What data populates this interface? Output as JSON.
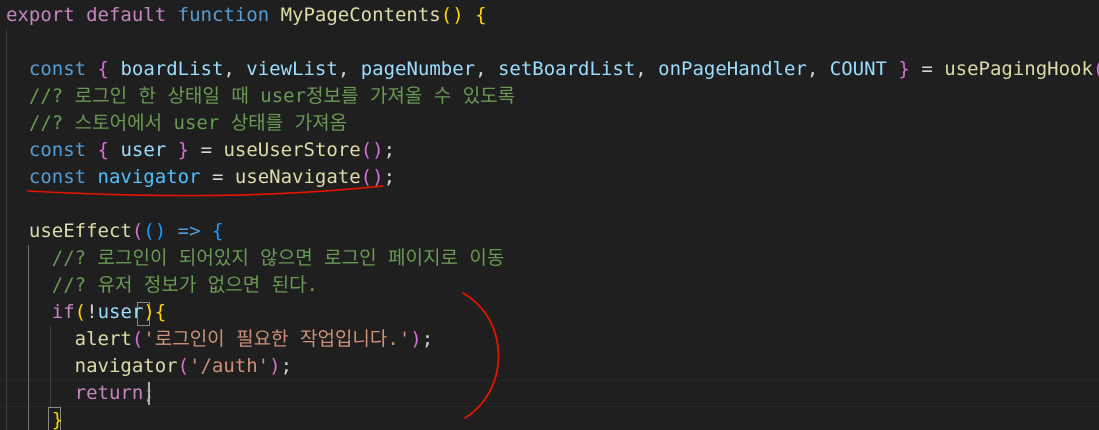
{
  "editor": {
    "colors": {
      "background": "#1f1f1f",
      "keyword": "#569cd6",
      "control_keyword": "#c586c0",
      "function": "#dcdcaa",
      "variable": "#9cdcfe",
      "constant": "#4fc1ff",
      "string": "#ce9178",
      "comment": "#6a9955",
      "bracket_level1": "#ffd700",
      "bracket_level2": "#da70d6",
      "bracket_level3": "#179fff",
      "annotation_ink": "#e51400"
    },
    "lines": [
      {
        "tokens": [
          {
            "t": "export",
            "c": "kw-ctrl"
          },
          {
            "t": " ",
            "c": "plain"
          },
          {
            "t": "default",
            "c": "kw-ctrl"
          },
          {
            "t": " ",
            "c": "plain"
          },
          {
            "t": "function",
            "c": "kw"
          },
          {
            "t": " ",
            "c": "plain"
          },
          {
            "t": "MyPageContents",
            "c": "fn"
          },
          {
            "t": "()",
            "c": "br1"
          },
          {
            "t": " ",
            "c": "plain"
          },
          {
            "t": "{",
            "c": "br1"
          }
        ]
      },
      {
        "tokens": []
      },
      {
        "tokens": [
          {
            "t": "  ",
            "c": "plain"
          },
          {
            "t": "const",
            "c": "kw"
          },
          {
            "t": " ",
            "c": "plain"
          },
          {
            "t": "{",
            "c": "br2"
          },
          {
            "t": " ",
            "c": "plain"
          },
          {
            "t": "boardList",
            "c": "var"
          },
          {
            "t": ", ",
            "c": "plain"
          },
          {
            "t": "viewList",
            "c": "var"
          },
          {
            "t": ", ",
            "c": "plain"
          },
          {
            "t": "pageNumber",
            "c": "var"
          },
          {
            "t": ", ",
            "c": "plain"
          },
          {
            "t": "setBoardList",
            "c": "var"
          },
          {
            "t": ", ",
            "c": "plain"
          },
          {
            "t": "onPageHandler",
            "c": "var"
          },
          {
            "t": ", ",
            "c": "plain"
          },
          {
            "t": "COUNT",
            "c": "var"
          },
          {
            "t": " ",
            "c": "plain"
          },
          {
            "t": "}",
            "c": "br2"
          },
          {
            "t": " = ",
            "c": "plain"
          },
          {
            "t": "usePagingHook",
            "c": "fn"
          },
          {
            "t": "()",
            "c": "br2"
          },
          {
            "t": ";",
            "c": "plain"
          }
        ]
      },
      {
        "tokens": [
          {
            "t": "  ",
            "c": "plain"
          },
          {
            "t": "//? 로그인 한 상태일 때 ",
            "c": "com"
          },
          {
            "t": "user",
            "c": "com"
          },
          {
            "t": "정보를 가져올 수 있도록",
            "c": "com"
          }
        ]
      },
      {
        "tokens": [
          {
            "t": "  ",
            "c": "plain"
          },
          {
            "t": "//? 스토어에서 ",
            "c": "com"
          },
          {
            "t": "user",
            "c": "com"
          },
          {
            "t": " 상태를 가져옴",
            "c": "com"
          }
        ]
      },
      {
        "tokens": [
          {
            "t": "  ",
            "c": "plain"
          },
          {
            "t": "const",
            "c": "kw"
          },
          {
            "t": " ",
            "c": "plain"
          },
          {
            "t": "{",
            "c": "br2"
          },
          {
            "t": " ",
            "c": "plain"
          },
          {
            "t": "user",
            "c": "var"
          },
          {
            "t": " ",
            "c": "plain"
          },
          {
            "t": "}",
            "c": "br2"
          },
          {
            "t": " = ",
            "c": "plain"
          },
          {
            "t": "useUserStore",
            "c": "fn"
          },
          {
            "t": "()",
            "c": "br2"
          },
          {
            "t": ";",
            "c": "plain"
          }
        ]
      },
      {
        "tokens": [
          {
            "t": "  ",
            "c": "plain"
          },
          {
            "t": "const",
            "c": "kw"
          },
          {
            "t": " ",
            "c": "plain"
          },
          {
            "t": "navigator",
            "c": "const"
          },
          {
            "t": " = ",
            "c": "plain"
          },
          {
            "t": "useNavigate",
            "c": "fn"
          },
          {
            "t": "()",
            "c": "br2"
          },
          {
            "t": ";",
            "c": "plain"
          }
        ]
      },
      {
        "tokens": []
      },
      {
        "tokens": [
          {
            "t": "  ",
            "c": "plain"
          },
          {
            "t": "useEffect",
            "c": "fn"
          },
          {
            "t": "(",
            "c": "br2"
          },
          {
            "t": "()",
            "c": "br3"
          },
          {
            "t": " ",
            "c": "plain"
          },
          {
            "t": "=>",
            "c": "kw"
          },
          {
            "t": " ",
            "c": "plain"
          },
          {
            "t": "{",
            "c": "br3"
          }
        ]
      },
      {
        "tokens": [
          {
            "t": "    ",
            "c": "plain"
          },
          {
            "t": "//? 로그인이 되어있지 않으면 로그인 페이지로 이동",
            "c": "com"
          }
        ]
      },
      {
        "tokens": [
          {
            "t": "    ",
            "c": "plain"
          },
          {
            "t": "//? 유저 정보가 없으면 된다.",
            "c": "com"
          }
        ]
      },
      {
        "tokens": [
          {
            "t": "    ",
            "c": "plain"
          },
          {
            "t": "if",
            "c": "kw-ctrl"
          },
          {
            "t": "(",
            "c": "br1"
          },
          {
            "t": "!",
            "c": "plain"
          },
          {
            "t": "user",
            "c": "var"
          },
          {
            "t": ")",
            "c": "br1"
          },
          {
            "t": "{",
            "c": "br1"
          }
        ]
      },
      {
        "tokens": [
          {
            "t": "      ",
            "c": "plain"
          },
          {
            "t": "alert",
            "c": "fn"
          },
          {
            "t": "(",
            "c": "br2"
          },
          {
            "t": "'로그인이 필요한 작업입니다.'",
            "c": "str"
          },
          {
            "t": ")",
            "c": "br2"
          },
          {
            "t": ";",
            "c": "plain"
          }
        ]
      },
      {
        "tokens": [
          {
            "t": "      ",
            "c": "plain"
          },
          {
            "t": "navigator",
            "c": "fn"
          },
          {
            "t": "(",
            "c": "br2"
          },
          {
            "t": "'/auth'",
            "c": "str"
          },
          {
            "t": ")",
            "c": "br2"
          },
          {
            "t": ";",
            "c": "plain"
          }
        ]
      },
      {
        "tokens": [
          {
            "t": "      ",
            "c": "plain"
          },
          {
            "t": "return",
            "c": "kw-ctrl"
          },
          {
            "t": ";",
            "c": "plain"
          }
        ]
      },
      {
        "tokens": [
          {
            "t": "    ",
            "c": "plain"
          },
          {
            "t": "}",
            "c": "br1"
          }
        ]
      }
    ]
  }
}
